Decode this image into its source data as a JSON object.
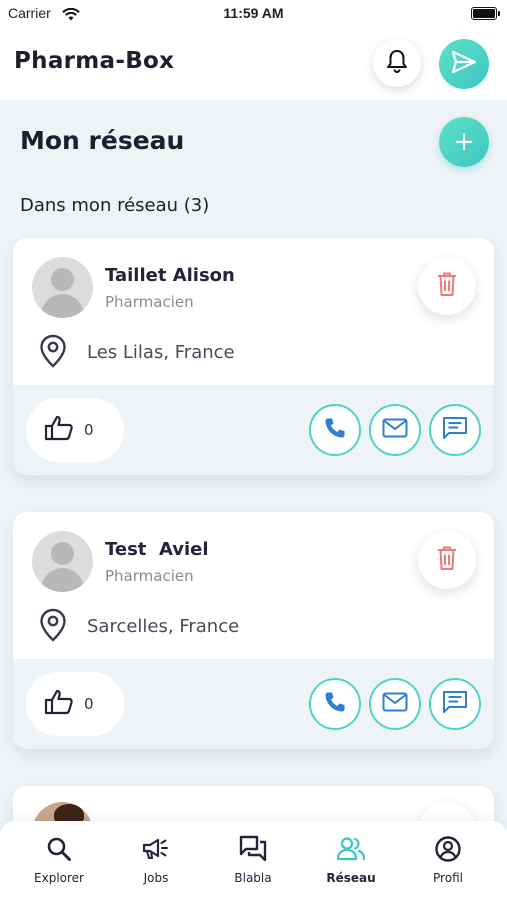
{
  "status_bar": {
    "carrier": "Carrier",
    "time": "11:59 AM"
  },
  "header": {
    "title": "Pharma-Box",
    "bell_icon": "bell-icon",
    "send_icon": "send-icon"
  },
  "section": {
    "title": "Mon réseau",
    "add_icon": "plus-icon",
    "add_label": "+",
    "count_label": "Dans mon réseau (3)"
  },
  "contacts": [
    {
      "name": "Taillet Alison",
      "role": "Pharmacien",
      "location": "Les Lilas, France",
      "likes": "0"
    },
    {
      "name": "Test  Aviel",
      "role": "Pharmacien",
      "location": "Sarcelles, France",
      "likes": "0"
    }
  ],
  "nav": {
    "items": [
      {
        "label": "Explorer",
        "icon": "search-icon"
      },
      {
        "label": "Jobs",
        "icon": "megaphone-icon"
      },
      {
        "label": "Blabla",
        "icon": "chat-bubbles-icon"
      },
      {
        "label": "Réseau",
        "icon": "users-icon",
        "active": true
      },
      {
        "label": "Profil",
        "icon": "profile-icon"
      }
    ]
  },
  "colors": {
    "accent": "#4fd3c4",
    "accent_gradient_start": "#5fe0c8",
    "delete": "#ee7a7a",
    "background": "#eef3f6",
    "active_nav": "#3cc6c0"
  }
}
